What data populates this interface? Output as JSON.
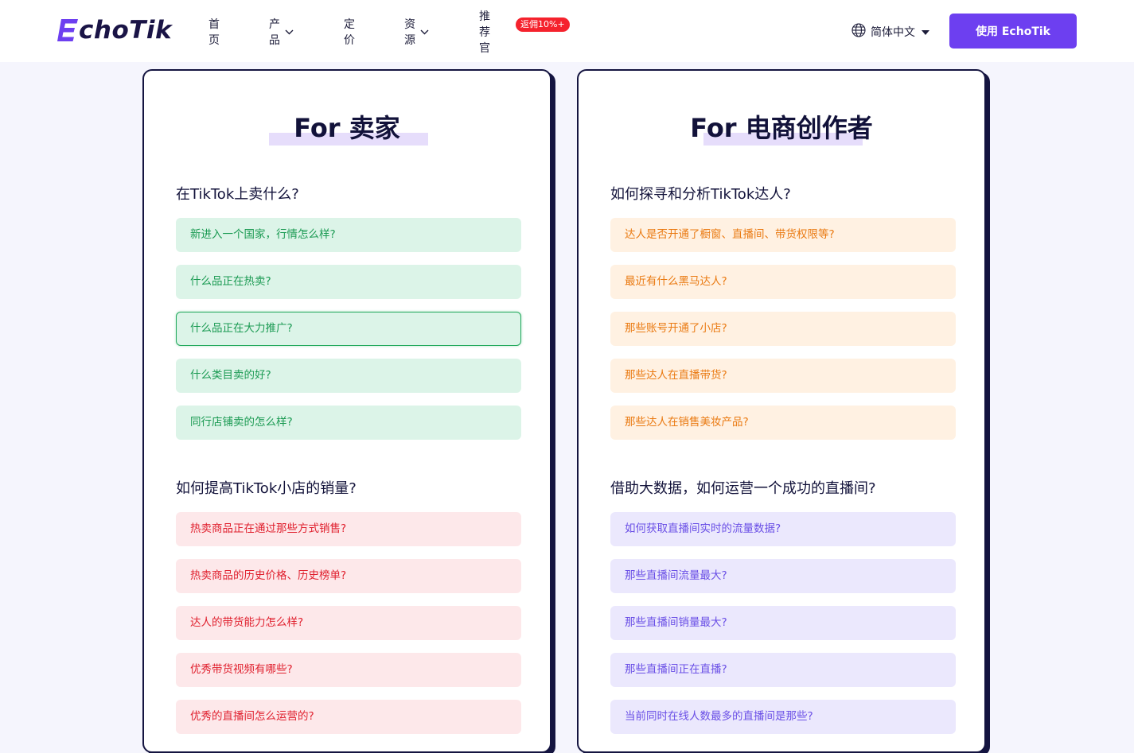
{
  "header": {
    "logo_text": "choTik",
    "nav": {
      "home": "首页",
      "products": "产品",
      "pricing": "定价",
      "resources": "资源",
      "referral": "推荐官",
      "referral_badge": "返佣10%+"
    },
    "language": "简体中文",
    "cta": "使用 EchoTik"
  },
  "colors": {
    "brand": "#6d3ff0",
    "badge": "#f5222d",
    "green_text": "#1a9a52",
    "red_text": "#e0202e",
    "orange_text": "#ea7a12",
    "purple_text": "#6a4fe6"
  },
  "sellers": {
    "title": "For 卖家",
    "section1": {
      "heading": "在TikTok上卖什么?",
      "items": [
        "新进入一个国家，行情怎么样?",
        "什么品正在热卖?",
        "什么品正在大力推广?",
        "什么类目卖的好?",
        "同行店铺卖的怎么样?"
      ]
    },
    "section2": {
      "heading": "如何提高TikTok小店的销量?",
      "items": [
        "热卖商品正在通过那些方式销售?",
        "热卖商品的历史价格、历史榜单?",
        "达人的带货能力怎么样?",
        "优秀带货视频有哪些?",
        "优秀的直播间怎么运营的?"
      ]
    }
  },
  "creators": {
    "title": "For 电商创作者",
    "section1": {
      "heading": "如何探寻和分析TikTok达人?",
      "items": [
        "达人是否开通了橱窗、直播间、带货权限等?",
        "最近有什么黑马达人?",
        "那些账号开通了小店?",
        "那些达人在直播带货?",
        "那些达人在销售美妆产品?"
      ]
    },
    "section2": {
      "heading": "借助大数据，如何运营一个成功的直播间?",
      "items": [
        "如何获取直播间实时的流量数据?",
        "那些直播间流量最大?",
        "那些直播间销量最大?",
        "那些直播间正在直播?",
        "当前同时在线人数最多的直播间是那些?"
      ]
    }
  }
}
